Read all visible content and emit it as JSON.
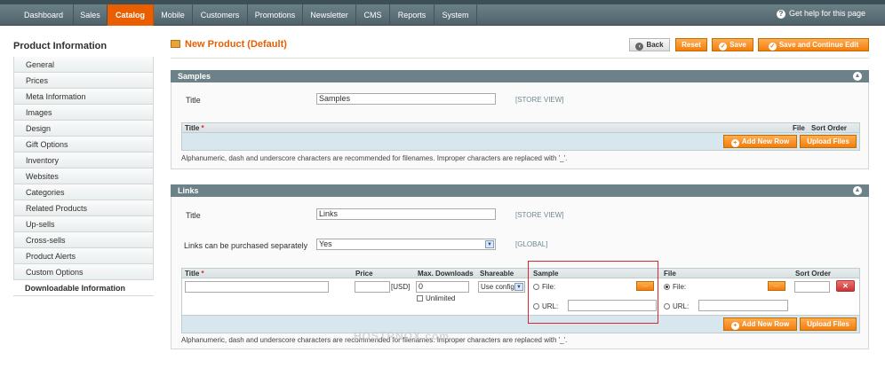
{
  "nav": {
    "items": [
      "Dashboard",
      "Sales",
      "Catalog",
      "Mobile",
      "Customers",
      "Promotions",
      "Newsletter",
      "CMS",
      "Reports",
      "System"
    ],
    "active": "Catalog",
    "help": "Get help for this page",
    "help_icon": "question-icon"
  },
  "sidebar": {
    "title": "Product Information",
    "items": [
      "General",
      "Prices",
      "Meta Information",
      "Images",
      "Design",
      "Gift Options",
      "Inventory",
      "Websites",
      "Categories",
      "Related Products",
      "Up-sells",
      "Cross-sells",
      "Product Alerts",
      "Custom Options",
      "Downloadable Information"
    ],
    "active": "Downloadable Information"
  },
  "page": {
    "title": "New Product (Default)",
    "buttons": {
      "back": "Back",
      "reset": "Reset",
      "save": "Save",
      "save_continue": "Save and Continue Edit"
    }
  },
  "samples": {
    "header": "Samples",
    "title_label": "Title",
    "title_value": "Samples",
    "scope": "[STORE VIEW]",
    "grid": {
      "col_title": "Title",
      "required": "*",
      "col_file": "File",
      "col_sort": "Sort Order"
    },
    "add_row": "Add New Row",
    "upload": "Upload Files",
    "note": "Alphanumeric, dash and underscore characters are recommended for filenames. Improper characters are replaced with '_'."
  },
  "links": {
    "header": "Links",
    "title_label": "Title",
    "title_value": "Links",
    "title_scope": "[STORE VIEW]",
    "purchase_label": "Links can be purchased separately",
    "purchase_value": "Yes",
    "purchase_scope": "[GLOBAL]",
    "grid": {
      "col_title": "Title",
      "required": "*",
      "col_price": "Price",
      "col_max": "Max. Downloads",
      "col_share": "Shareable",
      "col_sample": "Sample",
      "col_file": "File",
      "col_sort": "Sort Order"
    },
    "row": {
      "currency": "[USD]",
      "max_value": "0",
      "unlimited": "Unlimited",
      "share_value": "Use config",
      "file_label": "File:",
      "url_label": "URL:",
      "browse": "..."
    },
    "add_row": "Add New Row",
    "upload": "Upload Files",
    "note": "Alphanumeric, dash and underscore characters are recommended for filenames. Improper characters are replaced with '_'."
  },
  "watermark": "HOSTRNOX.com",
  "colors": {
    "accent": "#eb5e00",
    "header": "#6d8188",
    "highlight": "#d8272e"
  }
}
